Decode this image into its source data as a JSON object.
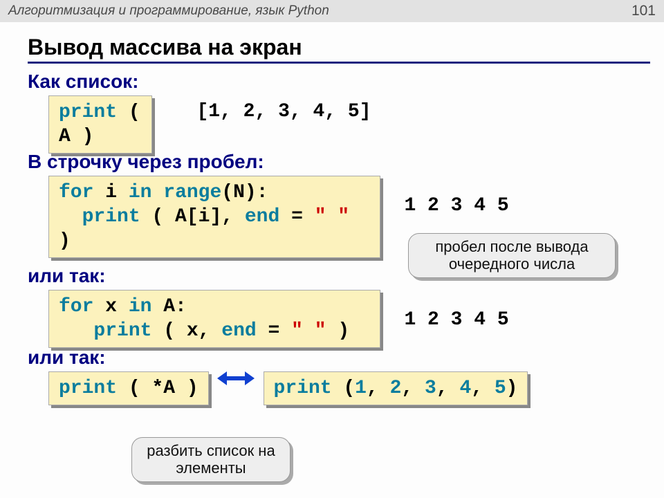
{
  "topbar": {
    "course": "Алгоритмизация и программирование, язык Python",
    "page": "101"
  },
  "title": "Вывод массива на экран",
  "labels": {
    "as_list": "Как список:",
    "inline_space": "В строчку через пробел:",
    "or1": "или так:",
    "or2": "или так:"
  },
  "code": {
    "c1_print": "print",
    "c1_tail": " ( A )",
    "c2_l1_for": "for",
    "c2_l1_mid": " i ",
    "c2_l1_in": "in",
    "c2_l1_sp": " ",
    "c2_l1_range": "range",
    "c2_l1_tail": "(N):",
    "c2_l2_print": "print",
    "c2_l2_mid": " ( A[i], ",
    "c2_l2_end": "end",
    "c2_l2_eq": " = ",
    "c2_l2_str": "\" \"",
    "c2_l2_close": " )",
    "c3_l1_for": "for",
    "c3_l1_mid": " x ",
    "c3_l1_in": "in",
    "c3_l1_tail": " A:",
    "c3_l2_print": "print",
    "c3_l2_mid": " (  x,  ",
    "c3_l2_end": "end",
    "c3_l2_eq": " = ",
    "c3_l2_str": "\" \"",
    "c3_l2_close": " )",
    "c4_print": "print",
    "c4_tail": " ( *A )",
    "c5_print": "print",
    "c5_open": " (",
    "c5_n1": "1",
    "c5_c": ", ",
    "c5_n2": "2",
    "c5_n3": "3",
    "c5_n4": "4",
    "c5_n5": "5",
    "c5_close": ")"
  },
  "outputs": {
    "o1": "[1, 2, 3, 4, 5]",
    "o2": "1 2 3 4 5",
    "o3": "1 2 3 4 5"
  },
  "callouts": {
    "space_after": "пробел после вывода очередного числа",
    "split_list": "разбить список на элементы"
  }
}
